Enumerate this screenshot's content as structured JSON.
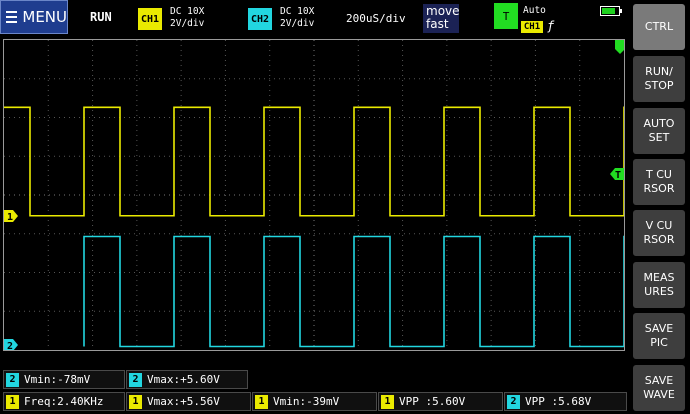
{
  "topbar": {
    "menu_label": "MENU",
    "run_status": "RUN",
    "ch1": {
      "tag": "CH1",
      "coupling": "DC 10X",
      "scale": "2V/div",
      "color": "#eaea00"
    },
    "ch2": {
      "tag": "CH2",
      "coupling": "DC 10X",
      "scale": "2V/div",
      "color": "#22d6e0"
    },
    "timebase": "200uS/div",
    "move_line1": "move",
    "move_line2": "fast",
    "trigger": {
      "tag": "T",
      "mode": "Auto",
      "source": "CH1",
      "edge": "ƒ",
      "color": "#22dd22"
    }
  },
  "markers": {
    "ch1": "1",
    "ch2": "2",
    "trigger": "T"
  },
  "right_menu": [
    {
      "label": "CTRL",
      "active": true
    },
    {
      "label": "RUN/\nSTOP",
      "active": false
    },
    {
      "label": "AUTO\nSET",
      "active": false
    },
    {
      "label": "T CU\nRSOR",
      "active": false
    },
    {
      "label": "V CU\nRSOR",
      "active": false
    },
    {
      "label": "MEAS\nURES",
      "active": false
    },
    {
      "label": "SAVE\nPIC",
      "active": false
    },
    {
      "label": "SAVE\nWAVE",
      "active": false
    }
  ],
  "measurements_row1": [
    {
      "ch": "2",
      "text": "Vmin:-78mV"
    },
    {
      "ch": "2",
      "text": "Vmax:+5.60V"
    }
  ],
  "measurements_row2": [
    {
      "ch": "1",
      "text": "Freq:2.40KHz"
    },
    {
      "ch": "1",
      "text": "Vmax:+5.56V"
    },
    {
      "ch": "1",
      "text": "Vmin:-39mV"
    },
    {
      "ch": "1",
      "text": "VPP :5.60V"
    },
    {
      "ch": "2",
      "text": "VPP :5.68V"
    }
  ],
  "chart_data": {
    "type": "line",
    "x_unit_per_div": "200uS",
    "y_unit_per_div": "2V",
    "series": [
      {
        "name": "CH1",
        "color": "#eaea00",
        "low_v": -0.039,
        "high_v": 5.56,
        "freq_hz": 2400,
        "duty": 0.4
      },
      {
        "name": "CH2",
        "color": "#22d6e0",
        "low_v": -0.078,
        "high_v": 5.6,
        "freq_hz": 2400,
        "duty": 0.4
      }
    ]
  }
}
